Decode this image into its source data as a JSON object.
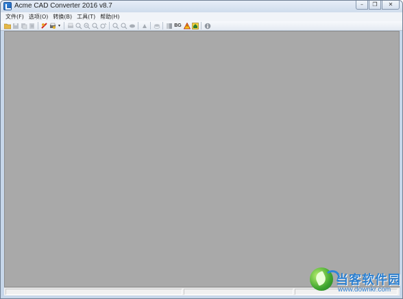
{
  "window": {
    "title": "Acme CAD Converter 2016 v8.7",
    "controls": {
      "minimize": "–",
      "restore": "❐",
      "close": "✕"
    }
  },
  "menu": [
    {
      "label": "文件(F)"
    },
    {
      "label": "选项(O)"
    },
    {
      "label": "转换(B)"
    },
    {
      "label": "工具(T)"
    },
    {
      "label": "帮助(H)"
    }
  ],
  "toolbar": {
    "bg_label": "BG",
    "icons": [
      "open-folder-icon",
      "save-icon",
      "batch-convert-icon",
      "export-icon",
      "layer-tool-icon",
      "print-setup-icon",
      "dropdown-arrow-icon",
      "print-icon",
      "zoom-in-icon",
      "zoom-out-icon",
      "zoom-window-icon",
      "zoom-realtime-icon",
      "zoom-extents-icon",
      "zoom-previous-icon",
      "pan-icon",
      "regen-icon",
      "layers-icon",
      "black-white-icon",
      "background-color-icon",
      "warning-icon",
      "home-icon",
      "about-icon"
    ]
  },
  "watermark": {
    "brand": "当客软件园",
    "url": "www.downkr.com"
  },
  "colors": {
    "workspace": "#a9a9a9",
    "watermark_blue": "#2c7fcf"
  }
}
